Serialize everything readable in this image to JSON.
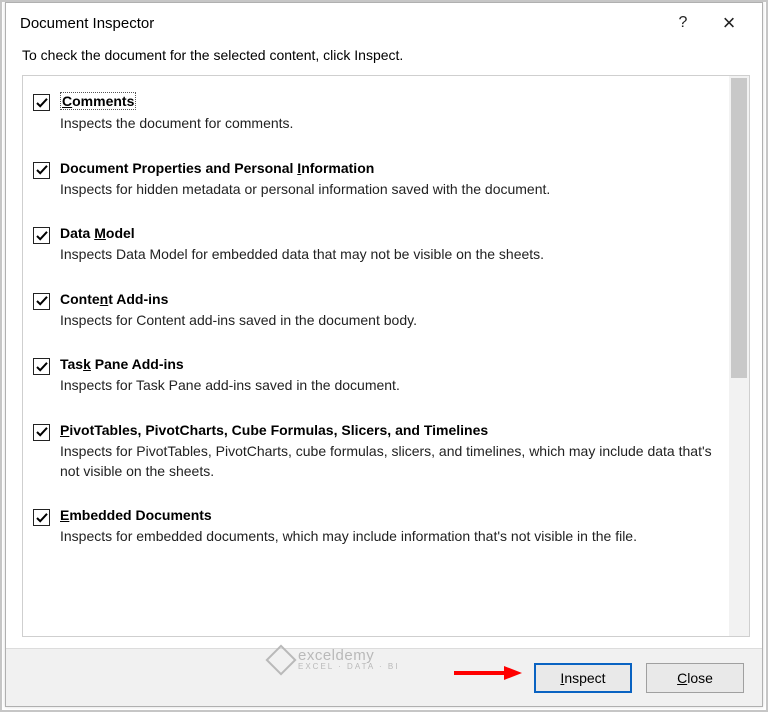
{
  "window": {
    "title": "Document Inspector",
    "help_icon": "?",
    "close_icon": "×"
  },
  "instruction": "To check the document for the selected content, click Inspect.",
  "items": [
    {
      "checked": true,
      "focused": true,
      "title_pre": "",
      "accel": "C",
      "title_post": "omments",
      "desc": "Inspects the document for comments."
    },
    {
      "checked": true,
      "title_pre": "Document Properties and Personal ",
      "accel": "I",
      "title_post": "nformation",
      "desc": "Inspects for hidden metadata or personal information saved with the document."
    },
    {
      "checked": true,
      "title_pre": "Data ",
      "accel": "M",
      "title_post": "odel",
      "desc": "Inspects Data Model for embedded data that may not be visible on the sheets."
    },
    {
      "checked": true,
      "title_pre": "Conte",
      "accel": "n",
      "title_post": "t Add-ins",
      "desc": "Inspects for Content add-ins saved in the document body."
    },
    {
      "checked": true,
      "title_pre": "Tas",
      "accel": "k",
      "title_post": " Pane Add-ins",
      "desc": "Inspects for Task Pane add-ins saved in the document."
    },
    {
      "checked": true,
      "title_pre": "",
      "accel": "P",
      "title_post": "ivotTables, PivotCharts, Cube Formulas, Slicers, and Timelines",
      "desc": "Inspects for PivotTables, PivotCharts, cube formulas, slicers, and timelines, which may include data that's not visible on the sheets."
    },
    {
      "checked": true,
      "title_pre": "",
      "accel": "E",
      "title_post": "mbedded Documents",
      "desc": "Inspects for embedded documents, which may include information that's not visible in the file."
    }
  ],
  "buttons": {
    "inspect_accel": "I",
    "inspect_rest": "nspect",
    "close_accel": "C",
    "close_rest": "lose"
  },
  "watermark": {
    "line1": "exceldemy",
    "line2": "EXCEL · DATA · BI"
  }
}
